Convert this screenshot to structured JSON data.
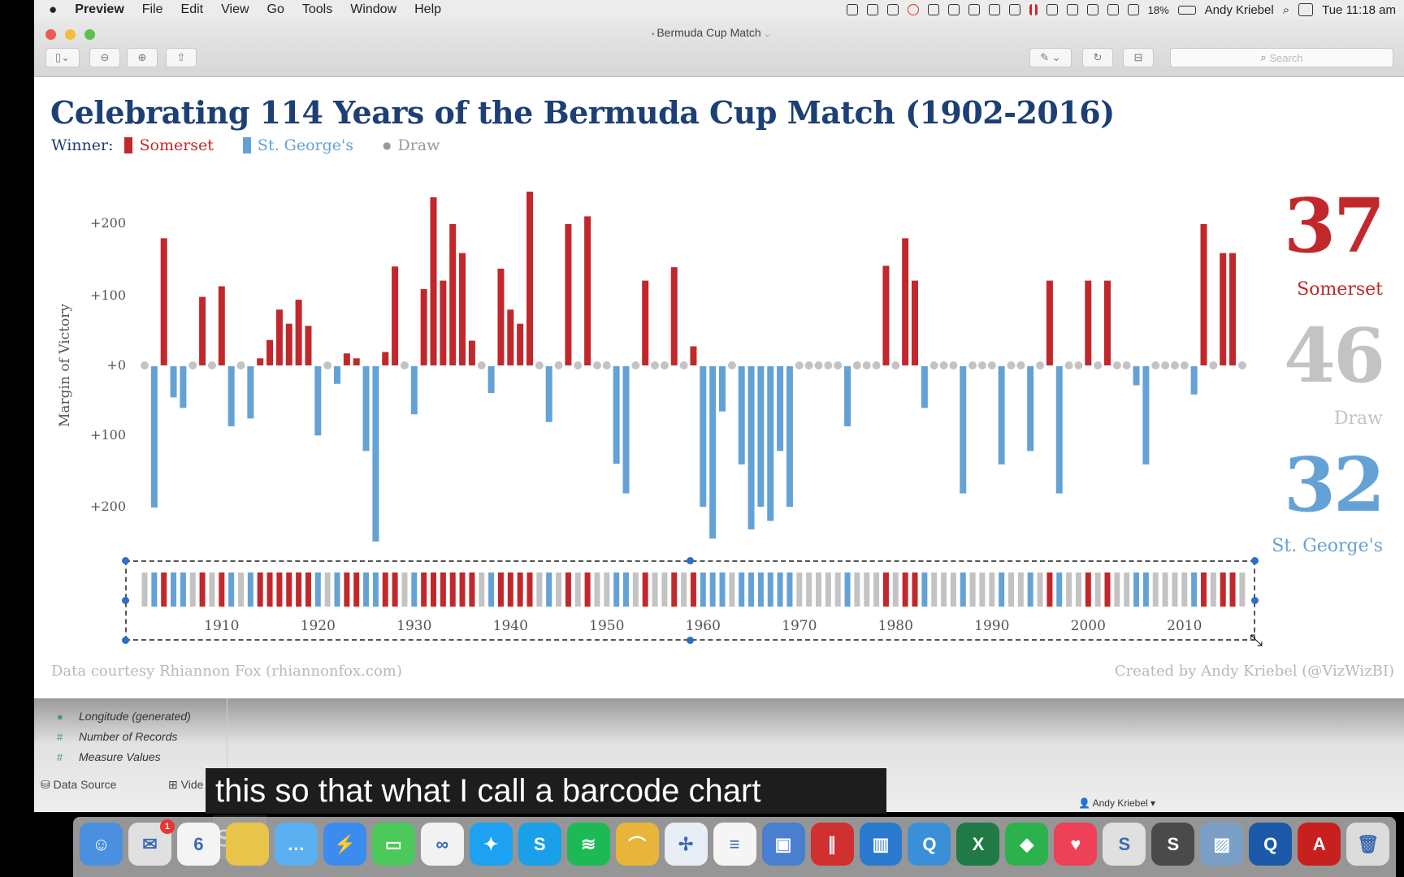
{
  "menubar": {
    "app": "Preview",
    "items": [
      "File",
      "Edit",
      "View",
      "Go",
      "Tools",
      "Window",
      "Help"
    ],
    "battery": "18%",
    "user": "Andy Kriebel",
    "clock": "Tue 11:18 am",
    "status_icons": [
      "creative-cloud-icon",
      "record-icon",
      "waves-icon",
      "badge-1-icon",
      "check-icon",
      "drive-icon",
      "tableau-icon",
      "clock-icon",
      "cloud-icon",
      "pause-icon",
      "display-icon",
      "bluetooth-icon",
      "volume-icon",
      "calendar-icon",
      "wifi-icon",
      "battery-icon",
      "spotlight-icon",
      "notification-icon"
    ]
  },
  "window": {
    "title": "Bermuda Cup Match",
    "search_placeholder": "Search"
  },
  "viz": {
    "title": "Celebrating 114 Years of the Bermuda Cup Match (1902-2016)",
    "legend": {
      "label": "Winner:",
      "somerset": "Somerset",
      "stgeorges": "St. George's",
      "draw": "Draw"
    },
    "totals": {
      "somerset": "37",
      "somerset_label": "Somerset",
      "draw": "46",
      "draw_label": "Draw",
      "stgeorges": "32",
      "stgeorges_label": "St. George's"
    },
    "credit_left": "Data courtesy Rhiannon Fox (rhiannonfox.com)",
    "credit_right": "Created by Andy Kriebel (@VizWizBI)"
  },
  "colors": {
    "somerset": "#c2282b",
    "stgeorges": "#64a2d6",
    "draw": "#c3c3c3",
    "title": "#1c3f75"
  },
  "chart_data": [
    {
      "type": "bar",
      "ylabel": "Margin of Victory",
      "ytick_labels": [
        "+200",
        "+100",
        "+0",
        "+100",
        "+200"
      ],
      "yticks": [
        200,
        100,
        0,
        -100,
        -200
      ],
      "ylim": [
        -250,
        250
      ],
      "x_start": 1902,
      "x_end": 2016,
      "note_sign": "positive = Somerset, negative = St. George's, 0 = Draw",
      "values": [
        0,
        -200,
        180,
        -44,
        -59,
        0,
        97,
        0,
        112,
        -85,
        0,
        -74,
        10,
        36,
        79,
        59,
        93,
        56,
        -98,
        0,
        -25,
        17,
        10,
        -120,
        -248,
        19,
        140,
        0,
        -68,
        108,
        238,
        120,
        200,
        159,
        35,
        0,
        -38,
        137,
        79,
        59,
        246,
        0,
        -79,
        0,
        200,
        0,
        211,
        0,
        0,
        -138,
        -180,
        0,
        120,
        0,
        0,
        139,
        0,
        27,
        -199,
        -244,
        -64,
        0,
        -139,
        -231,
        -199,
        -219,
        -120,
        -199,
        0,
        0,
        0,
        0,
        0,
        -85,
        0,
        0,
        0,
        141,
        0,
        180,
        120,
        -59,
        0,
        0,
        0,
        -180,
        0,
        0,
        0,
        -139,
        0,
        0,
        -120,
        0,
        120,
        -180,
        0,
        0,
        120,
        0,
        120,
        0,
        0,
        -27,
        -139,
        0,
        0,
        0,
        0,
        -40,
        200,
        0,
        159,
        159,
        0
      ]
    },
    {
      "type": "barcode",
      "xtick_labels": [
        "1910",
        "1920",
        "1930",
        "1940",
        "1950",
        "1960",
        "1970",
        "1980",
        "1990",
        "2000",
        "2010"
      ]
    }
  ],
  "tableau": {
    "fields": [
      "Longitude (generated)",
      "Number of Records",
      "Measure Values"
    ],
    "tabs": [
      "Data Source",
      "Vide"
    ],
    "user": "Andy Kriebel"
  },
  "caption": {
    "line1": "this so that what I call a barcode chart",
    "line2": "so"
  },
  "dock": [
    {
      "name": "finder-icon",
      "color": "#4a8fe0",
      "glyph": "☺"
    },
    {
      "name": "mail-icon",
      "color": "#e0e0e0",
      "glyph": "✉",
      "badge": "1"
    },
    {
      "name": "calendar-icon",
      "color": "#f4f4f4",
      "glyph": "6"
    },
    {
      "name": "photos-icon",
      "color": "#e8c44a",
      "glyph": ""
    },
    {
      "name": "messages-icon",
      "color": "#5ab0f0",
      "glyph": "…"
    },
    {
      "name": "messenger-icon",
      "color": "#3c8cf0",
      "glyph": "⚡"
    },
    {
      "name": "imessage-icon",
      "color": "#4cc95a",
      "glyph": "▭"
    },
    {
      "name": "creative-cloud-icon",
      "color": "#f2f2f2",
      "glyph": "∞"
    },
    {
      "name": "twitter-icon",
      "color": "#1da1f2",
      "glyph": "✦"
    },
    {
      "name": "skype-icon",
      "color": "#1aa0e8",
      "glyph": "S"
    },
    {
      "name": "spotify-icon",
      "color": "#1db954",
      "glyph": "≋"
    },
    {
      "name": "alfred-icon",
      "color": "#e8b43a",
      "glyph": "⌒"
    },
    {
      "name": "tableau-icon",
      "color": "#e8eef6",
      "glyph": "✢"
    },
    {
      "name": "reminders-icon",
      "color": "#f5f5f5",
      "glyph": "≡"
    },
    {
      "name": "keynote-icon",
      "color": "#4a7fd0",
      "glyph": "▣"
    },
    {
      "name": "parallels-icon",
      "color": "#d03030",
      "glyph": "∥"
    },
    {
      "name": "trello-icon",
      "color": "#2a7ad0",
      "glyph": "▥"
    },
    {
      "name": "qlik-icon",
      "color": "#3a90d8",
      "glyph": "Q"
    },
    {
      "name": "excel-icon",
      "color": "#1f7a45",
      "glyph": "X"
    },
    {
      "name": "feedly-icon",
      "color": "#2bb24c",
      "glyph": "◆"
    },
    {
      "name": "pocket-icon",
      "color": "#ee4056",
      "glyph": "♥"
    },
    {
      "name": "slack-icon",
      "color": "#e0e0e0",
      "glyph": "S"
    },
    {
      "name": "sublime-icon",
      "color": "#4a4a4a",
      "glyph": "S"
    },
    {
      "name": "preview-icon",
      "color": "#7aa0c8",
      "glyph": "▨"
    },
    {
      "name": "qlik-sense-icon",
      "color": "#1a5aa8",
      "glyph": "Q"
    },
    {
      "name": "acrobat-icon",
      "color": "#c8201e",
      "glyph": "A"
    },
    {
      "name": "trash-icon",
      "color": "#dcdcdc",
      "glyph": "🗑"
    }
  ]
}
